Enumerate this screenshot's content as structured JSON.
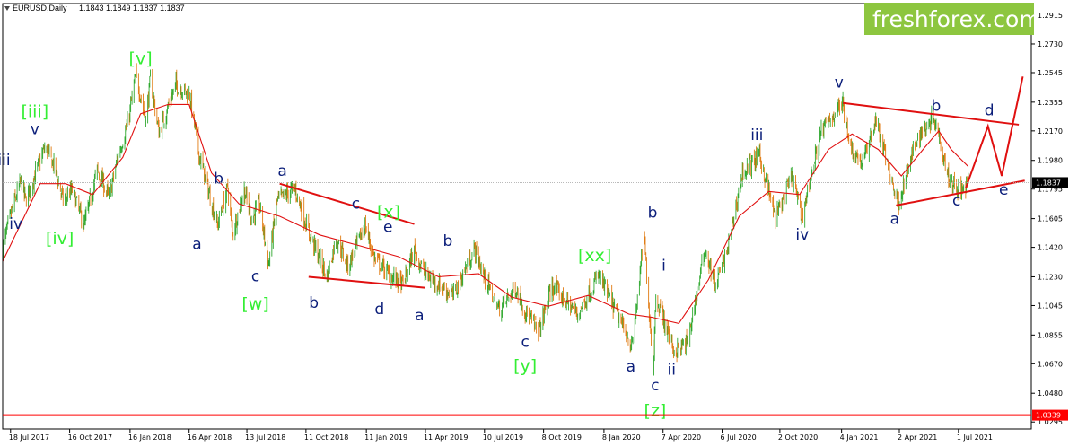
{
  "chart_data": {
    "type": "candlestick",
    "symbol_header": "EURUSD,Daily",
    "ohlc_header": "1.1843 1.1849 1.1837 1.1837",
    "logo_text": "freshforex.com",
    "price_labels": [
      "1.2915",
      "1.2730",
      "1.2545",
      "1.2355",
      "1.2170",
      "1.1980",
      "1.1795",
      "1.1605",
      "1.1420",
      "1.1230",
      "1.1045",
      "1.0855",
      "1.0670",
      "1.0480",
      "1.0295"
    ],
    "price_ticks": [
      1.2915,
      1.273,
      1.2545,
      1.2355,
      1.217,
      1.198,
      1.1795,
      1.1605,
      1.142,
      1.123,
      1.1045,
      1.0855,
      1.067,
      1.048,
      1.0295
    ],
    "date_labels": [
      "18 Jul 2017",
      "16 Oct 2017",
      "16 Jan 2018",
      "16 Apr 2018",
      "13 Jul 2018",
      "11 Oct 2018",
      "11 Jan 2019",
      "11 Apr 2019",
      "10 Jul 2019",
      "8 Oct 2019",
      "8 Jan 2020",
      "7 Apr 2020",
      "6 Jul 2020",
      "2 Oct 2020",
      "4 Jan 2021",
      "2 Apr 2021",
      "1 Jul 2021"
    ],
    "current_price": "1.1837",
    "current_price_value": 1.1837,
    "support_price": "1.0339",
    "support_price_value": 1.0339,
    "ylim": [
      1.025,
      1.299
    ],
    "xlim": [
      "2017-07-06",
      "2021-10-20"
    ],
    "price_path": [
      [
        "2017-07-06",
        1.142
      ],
      [
        "2017-07-20",
        1.166
      ],
      [
        "2017-08-03",
        1.185
      ],
      [
        "2017-08-10",
        1.172
      ],
      [
        "2017-08-25",
        1.19
      ],
      [
        "2017-09-08",
        1.206
      ],
      [
        "2017-09-22",
        1.195
      ],
      [
        "2017-10-06",
        1.172
      ],
      [
        "2017-10-20",
        1.179
      ],
      [
        "2017-11-07",
        1.156
      ],
      [
        "2017-11-27",
        1.192
      ],
      [
        "2017-12-15",
        1.174
      ],
      [
        "2017-12-29",
        1.201
      ],
      [
        "2018-01-12",
        1.221
      ],
      [
        "2018-01-25",
        1.253
      ],
      [
        "2018-02-09",
        1.224
      ],
      [
        "2018-02-16",
        1.25
      ],
      [
        "2018-03-01",
        1.216
      ],
      [
        "2018-03-27",
        1.247
      ],
      [
        "2018-04-17",
        1.24
      ],
      [
        "2018-05-01",
        1.202
      ],
      [
        "2018-05-29",
        1.156
      ],
      [
        "2018-06-14",
        1.181
      ],
      [
        "2018-06-21",
        1.151
      ],
      [
        "2018-07-09",
        1.179
      ],
      [
        "2018-07-20",
        1.16
      ],
      [
        "2018-08-01",
        1.17
      ],
      [
        "2018-08-15",
        1.131
      ],
      [
        "2018-08-28",
        1.172
      ],
      [
        "2018-09-24",
        1.18
      ],
      [
        "2018-10-15",
        1.152
      ],
      [
        "2018-11-12",
        1.123
      ],
      [
        "2018-11-26",
        1.148
      ],
      [
        "2018-12-14",
        1.13
      ],
      [
        "2019-01-09",
        1.156
      ],
      [
        "2019-01-23",
        1.135
      ],
      [
        "2019-02-14",
        1.125
      ],
      [
        "2019-03-07",
        1.118
      ],
      [
        "2019-03-25",
        1.14
      ],
      [
        "2019-04-10",
        1.125
      ],
      [
        "2019-05-23",
        1.111
      ],
      [
        "2019-06-25",
        1.141
      ],
      [
        "2019-07-10",
        1.122
      ],
      [
        "2019-08-01",
        1.102
      ],
      [
        "2019-08-26",
        1.116
      ],
      [
        "2019-09-13",
        1.098
      ],
      [
        "2019-10-01",
        1.088
      ],
      [
        "2019-10-21",
        1.117
      ],
      [
        "2019-11-29",
        1.099
      ],
      [
        "2019-12-31",
        1.124
      ],
      [
        "2020-02-20",
        1.078
      ],
      [
        "2020-03-09",
        1.149
      ],
      [
        "2020-03-23",
        1.064
      ],
      [
        "2020-03-27",
        1.111
      ],
      [
        "2020-04-24",
        1.075
      ],
      [
        "2020-05-14",
        1.08
      ],
      [
        "2020-06-10",
        1.141
      ],
      [
        "2020-06-26",
        1.117
      ],
      [
        "2020-07-15",
        1.142
      ],
      [
        "2020-08-06",
        1.19
      ],
      [
        "2020-09-01",
        1.201
      ],
      [
        "2020-09-25",
        1.161
      ],
      [
        "2020-10-21",
        1.188
      ],
      [
        "2020-11-04",
        1.161
      ],
      [
        "2020-12-04",
        1.217
      ],
      [
        "2021-01-06",
        1.235
      ],
      [
        "2021-01-18",
        1.206
      ],
      [
        "2021-02-05",
        1.196
      ],
      [
        "2021-02-25",
        1.224
      ],
      [
        "2021-03-31",
        1.17
      ],
      [
        "2021-04-29",
        1.212
      ],
      [
        "2021-05-25",
        1.227
      ],
      [
        "2021-06-17",
        1.186
      ],
      [
        "2021-07-07",
        1.178
      ],
      [
        "2021-07-16",
        1.1837
      ]
    ],
    "ma_path": [
      [
        "2017-07-06",
        1.133
      ],
      [
        "2017-09-01",
        1.183
      ],
      [
        "2017-10-10",
        1.183
      ],
      [
        "2017-11-20",
        1.176
      ],
      [
        "2018-01-05",
        1.2
      ],
      [
        "2018-02-01",
        1.228
      ],
      [
        "2018-03-15",
        1.234
      ],
      [
        "2018-04-16",
        1.234
      ],
      [
        "2018-05-20",
        1.19
      ],
      [
        "2018-07-01",
        1.17
      ],
      [
        "2018-09-01",
        1.162
      ],
      [
        "2018-11-01",
        1.15
      ],
      [
        "2019-01-01",
        1.143
      ],
      [
        "2019-03-01",
        1.136
      ],
      [
        "2019-05-01",
        1.123
      ],
      [
        "2019-07-01",
        1.125
      ],
      [
        "2019-08-20",
        1.11
      ],
      [
        "2019-10-15",
        1.104
      ],
      [
        "2019-12-15",
        1.111
      ],
      [
        "2020-02-15",
        1.099
      ],
      [
        "2020-03-20",
        1.097
      ],
      [
        "2020-05-01",
        1.093
      ],
      [
        "2020-06-15",
        1.121
      ],
      [
        "2020-08-01",
        1.162
      ],
      [
        "2020-09-15",
        1.178
      ],
      [
        "2020-11-01",
        1.176
      ],
      [
        "2020-12-15",
        1.205
      ],
      [
        "2021-01-20",
        1.215
      ],
      [
        "2021-03-01",
        1.205
      ],
      [
        "2021-04-05",
        1.188
      ],
      [
        "2021-05-10",
        1.206
      ],
      [
        "2021-06-01",
        1.217
      ],
      [
        "2021-06-20",
        1.205
      ],
      [
        "2021-07-16",
        1.194
      ]
    ],
    "trend_lines": [
      {
        "from": [
          "2018-09-01",
          1.183
        ],
        "to": [
          "2019-03-25",
          1.157
        ]
      },
      {
        "from": [
          "2018-10-15",
          1.123
        ],
        "to": [
          "2019-04-10",
          1.116
        ]
      },
      {
        "from": [
          "2021-01-06",
          1.235
        ],
        "to": [
          "2021-10-01",
          1.221
        ]
      },
      {
        "from": [
          "2021-03-28",
          1.169
        ],
        "to": [
          "2021-10-10",
          1.185
        ]
      }
    ],
    "projection": [
      [
        "2021-07-12",
        1.18
      ],
      [
        "2021-08-15",
        1.22
      ],
      [
        "2021-09-05",
        1.188
      ],
      [
        "2021-10-07",
        1.252
      ]
    ],
    "wave_labels": [
      {
        "text": "iii",
        "date": "2017-07-08",
        "price": 1.195,
        "color": "blue"
      },
      {
        "text": "iv",
        "date": "2017-07-26",
        "price": 1.154,
        "color": "blue"
      },
      {
        "text": "v",
        "date": "2017-08-24",
        "price": 1.215,
        "color": "blue"
      },
      {
        "text": "[iii]",
        "date": "2017-08-24",
        "price": 1.226,
        "color": "green"
      },
      {
        "text": "[iv]",
        "date": "2017-10-01",
        "price": 1.144,
        "color": "green"
      },
      {
        "text": "[v]",
        "date": "2018-02-01",
        "price": 1.26,
        "color": "green"
      },
      {
        "text": "a",
        "date": "2018-04-28",
        "price": 1.141,
        "color": "blue"
      },
      {
        "text": "b",
        "date": "2018-05-31",
        "price": 1.183,
        "color": "blue"
      },
      {
        "text": "c",
        "date": "2018-07-26",
        "price": 1.12,
        "color": "blue"
      },
      {
        "text": "[w]",
        "date": "2018-07-26",
        "price": 1.102,
        "color": "green"
      },
      {
        "text": "a",
        "date": "2018-09-05",
        "price": 1.188,
        "color": "blue"
      },
      {
        "text": "b",
        "date": "2018-10-23",
        "price": 1.103,
        "color": "blue"
      },
      {
        "text": "c",
        "date": "2018-12-26",
        "price": 1.167,
        "color": "blue"
      },
      {
        "text": "[x]",
        "date": "2019-02-14",
        "price": 1.161,
        "color": "green"
      },
      {
        "text": "e",
        "date": "2019-02-13",
        "price": 1.152,
        "color": "blue"
      },
      {
        "text": "d",
        "date": "2019-01-31",
        "price": 1.099,
        "color": "blue"
      },
      {
        "text": "a",
        "date": "2019-04-02",
        "price": 1.095,
        "color": "blue"
      },
      {
        "text": "b",
        "date": "2019-05-15",
        "price": 1.143,
        "color": "blue"
      },
      {
        "text": "c",
        "date": "2019-09-10",
        "price": 1.078,
        "color": "blue"
      },
      {
        "text": "[y]",
        "date": "2019-09-10",
        "price": 1.062,
        "color": "green"
      },
      {
        "text": "[xx]",
        "date": "2019-12-25",
        "price": 1.133,
        "color": "green"
      },
      {
        "text": "a",
        "date": "2020-02-18",
        "price": 1.062,
        "color": "blue"
      },
      {
        "text": "b",
        "date": "2020-03-22",
        "price": 1.161,
        "color": "blue"
      },
      {
        "text": "i",
        "date": "2020-04-08",
        "price": 1.127,
        "color": "blue"
      },
      {
        "text": "c",
        "date": "2020-03-26",
        "price": 1.05,
        "color": "blue"
      },
      {
        "text": "[z]",
        "date": "2020-03-26",
        "price": 1.033,
        "color": "green"
      },
      {
        "text": "ii",
        "date": "2020-04-20",
        "price": 1.06,
        "color": "blue"
      },
      {
        "text": "iii",
        "date": "2020-08-28",
        "price": 1.211,
        "color": "blue"
      },
      {
        "text": "iv",
        "date": "2020-11-05",
        "price": 1.147,
        "color": "blue"
      },
      {
        "text": "v",
        "date": "2020-12-31",
        "price": 1.245,
        "color": "blue"
      },
      {
        "text": "a",
        "date": "2021-03-26",
        "price": 1.157,
        "color": "blue"
      },
      {
        "text": "b",
        "date": "2021-05-28",
        "price": 1.23,
        "color": "blue"
      },
      {
        "text": "c",
        "date": "2021-06-28",
        "price": 1.169,
        "color": "blue"
      },
      {
        "text": "d",
        "date": "2021-08-17",
        "price": 1.227,
        "color": "blue"
      },
      {
        "text": "e",
        "date": "2021-09-08",
        "price": 1.176,
        "color": "blue"
      }
    ]
  },
  "colors": {
    "bull": "#2fa82f",
    "bear": "#e07a10",
    "ma": "#e01010",
    "trend": "#e01010",
    "wave_blue": "#0b1e7a",
    "wave_green": "#33ee33",
    "logo_bg": "#8dc63f",
    "support_line": "#ff0000",
    "grid_axis": "#000000"
  }
}
